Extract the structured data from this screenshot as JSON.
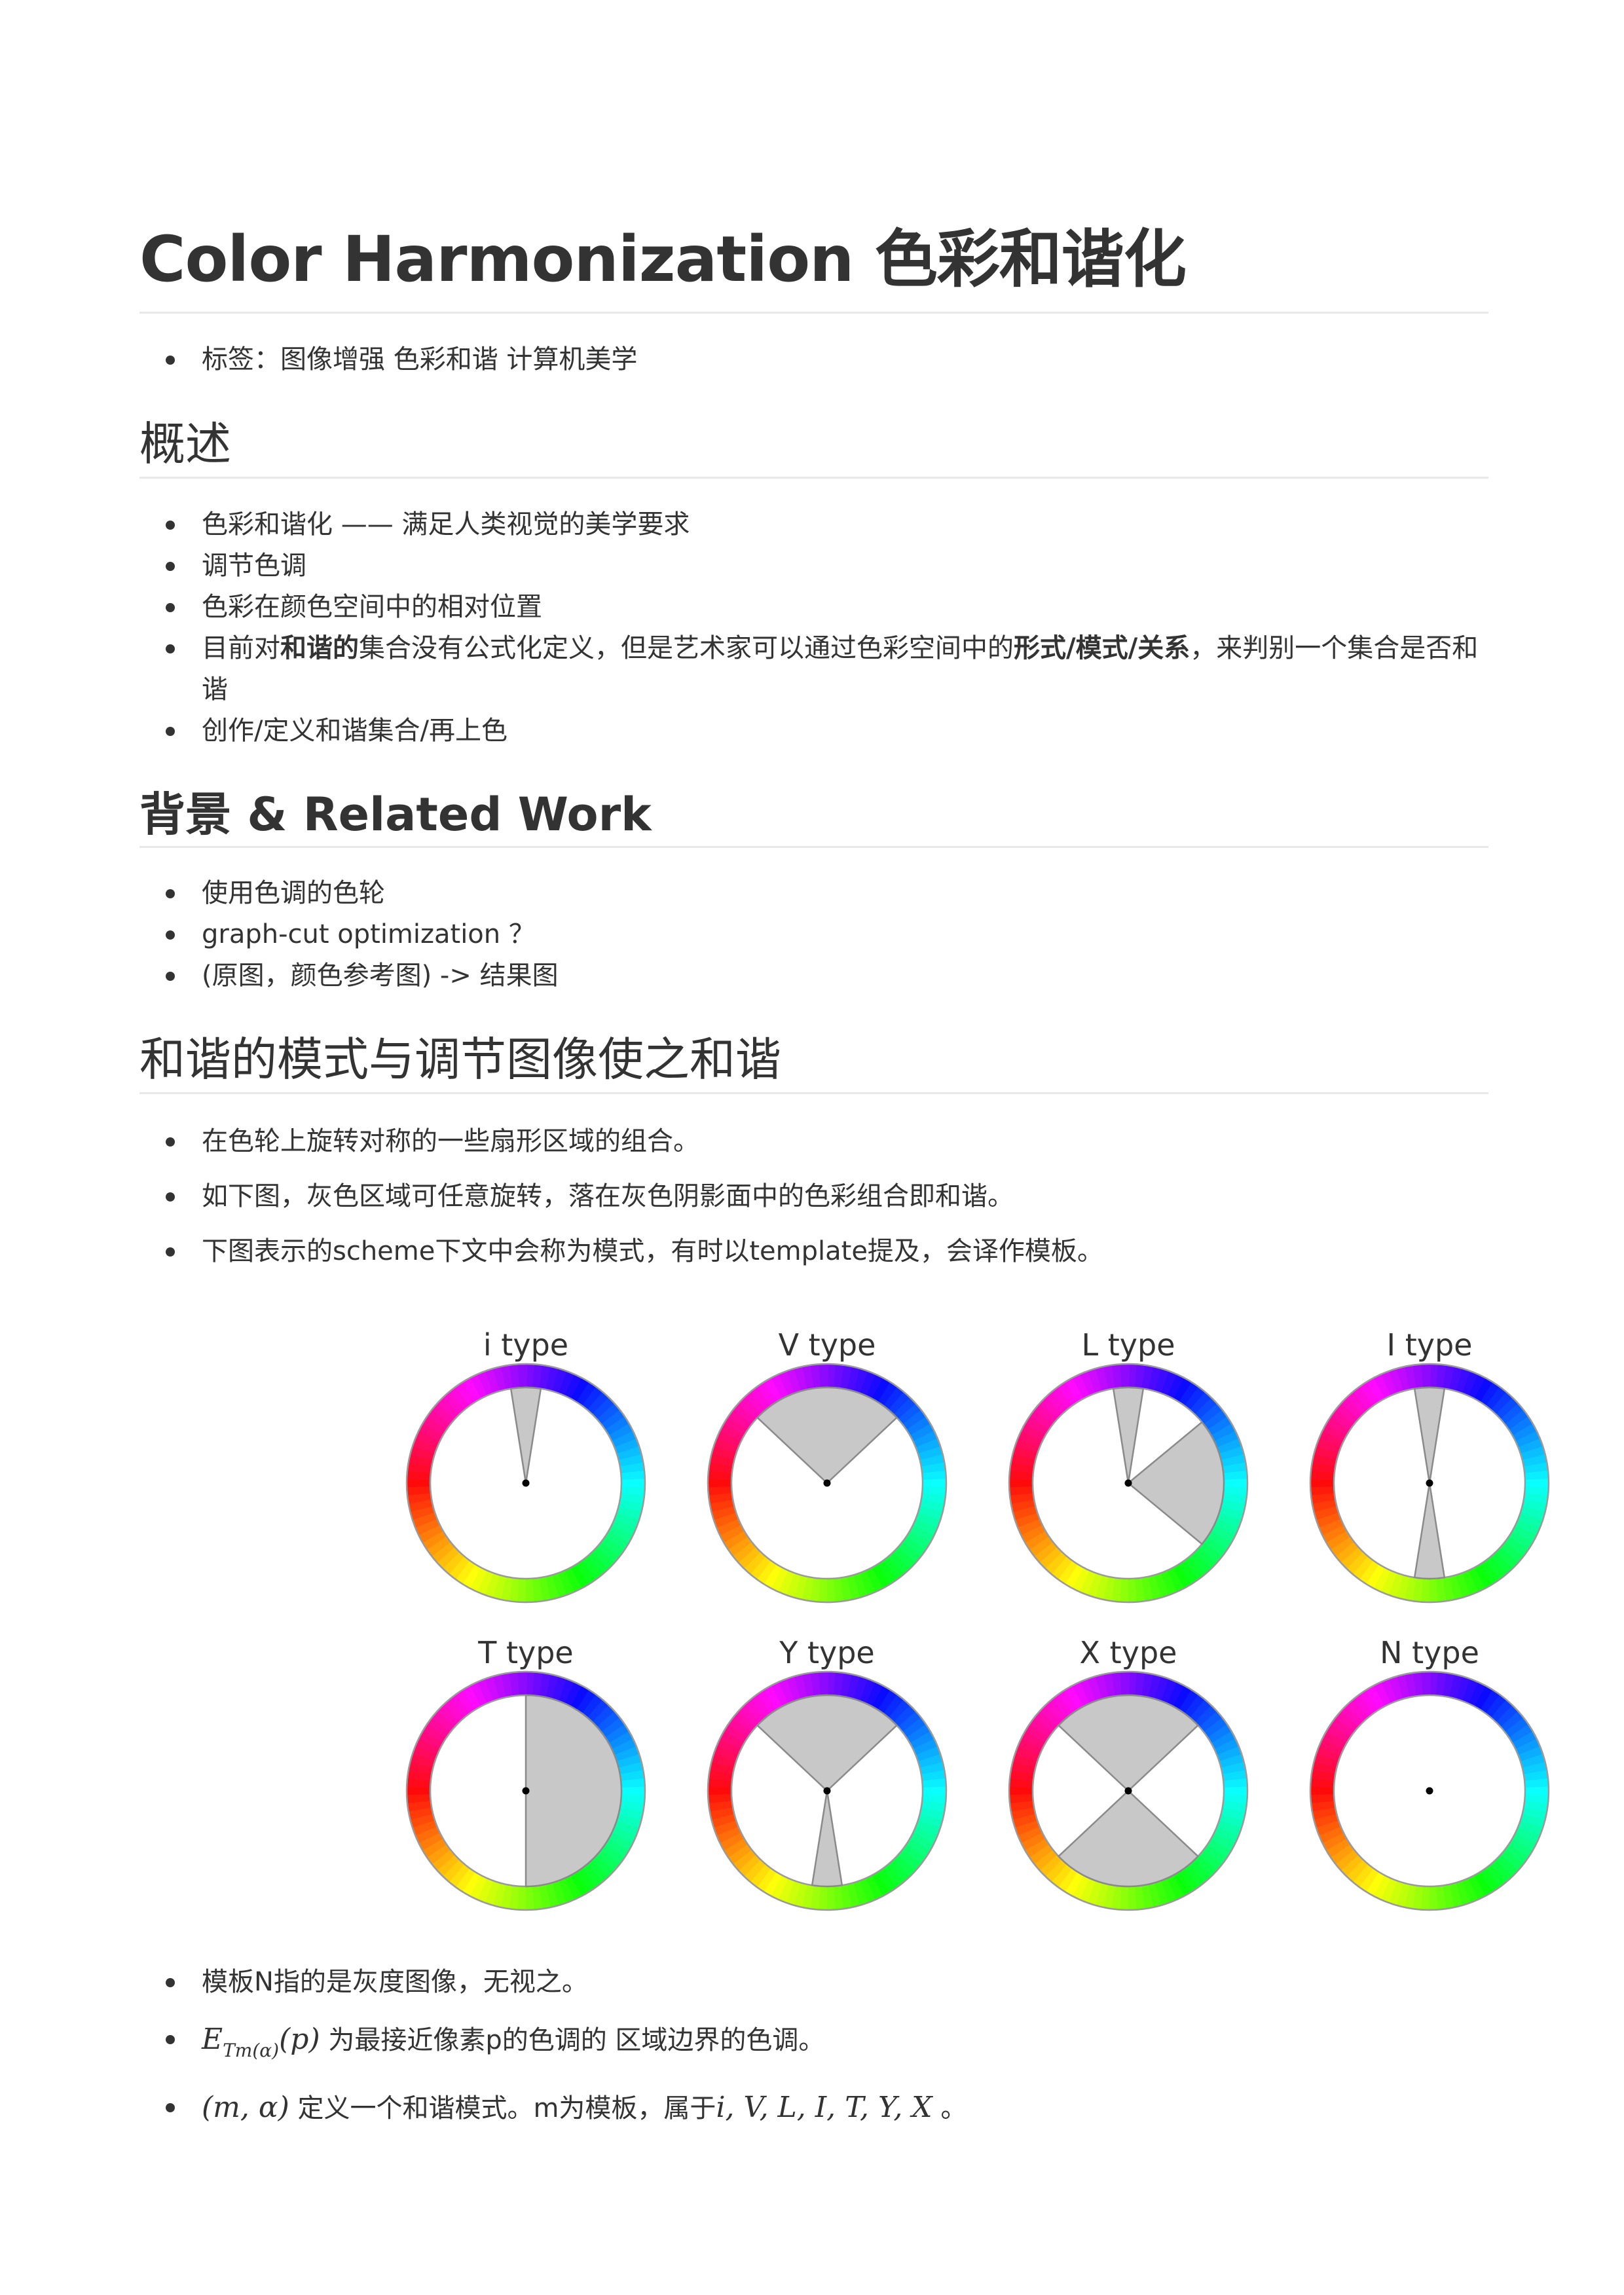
{
  "title": "Color Harmonization 色彩和谐化",
  "tags": {
    "label": "标签：",
    "values": "图像增强 色彩和谐 计算机美学"
  },
  "overview": {
    "heading": "概述",
    "item1": "色彩和谐化 —— 满足人类视觉的美学要求",
    "item2": "调节色调",
    "item3": "色彩在颜色空间中的相对位置",
    "item4_a": "目前对",
    "item4_b": "和谐的",
    "item4_c": "集合没有公式化定义，但是艺术家可以通过色彩空间中的",
    "item4_d": "形式/模式/关系",
    "item4_e": "，来判别一个集合是否和谐",
    "item5": "创作/定义和谐集合/再上色"
  },
  "background": {
    "heading": "背景 & Related Work",
    "item1": "使用色调的色轮",
    "item2": "graph-cut optimization ？",
    "item3": "(原图，颜色参考图) -> 结果图"
  },
  "templates_section": {
    "heading": "和谐的模式与调节图像使之和谐",
    "item1": "在色轮上旋转对称的一些扇形区域的组合。",
    "item2": "如下图，灰色区域可任意旋转，落在灰色阴影面中的色彩组合即和谐。",
    "item3": "下图表示的scheme下文中会称为模式，有时以template提及，会译作模板。"
  },
  "wheel_templates": [
    {
      "name": "i type",
      "sectors": [
        {
          "center": 0,
          "width": 18
        }
      ]
    },
    {
      "name": "V type",
      "sectors": [
        {
          "center": 0,
          "width": 93.6
        }
      ]
    },
    {
      "name": "L type",
      "sectors": [
        {
          "center": 0,
          "width": 18
        },
        {
          "center": 90,
          "width": 79.2
        }
      ]
    },
    {
      "name": "I type",
      "sectors": [
        {
          "center": 0,
          "width": 18
        },
        {
          "center": 180,
          "width": 18
        }
      ]
    },
    {
      "name": "T type",
      "sectors": [
        {
          "center": 90,
          "width": 180
        }
      ]
    },
    {
      "name": "Y type",
      "sectors": [
        {
          "center": 0,
          "width": 93.6
        },
        {
          "center": 180,
          "width": 18
        }
      ]
    },
    {
      "name": "X type",
      "sectors": [
        {
          "center": 0,
          "width": 93.6
        },
        {
          "center": 180,
          "width": 93.6
        }
      ]
    },
    {
      "name": "N type",
      "sectors": []
    }
  ],
  "colors": {
    "sector_fill": "#c8c8c8",
    "sector_stroke": "#8a8a8a",
    "text": "#333333",
    "rule": "#e8e8e8"
  },
  "notes": {
    "item1": "模板N指的是灰度图像，无视之。",
    "item2_math_main": "E",
    "item2_math_sub": "Tm(α)",
    "item2_math_arg": "(p)",
    "item2_text": " 为最接近像素p的色调的 区域边界的色调。",
    "item3_math": "(m, α)",
    "item3_text_a": " 定义一个和谐模式。m为模板，属于",
    "item3_math_set": "i, V, L, I, T, Y, X",
    "item3_text_b": " 。"
  }
}
